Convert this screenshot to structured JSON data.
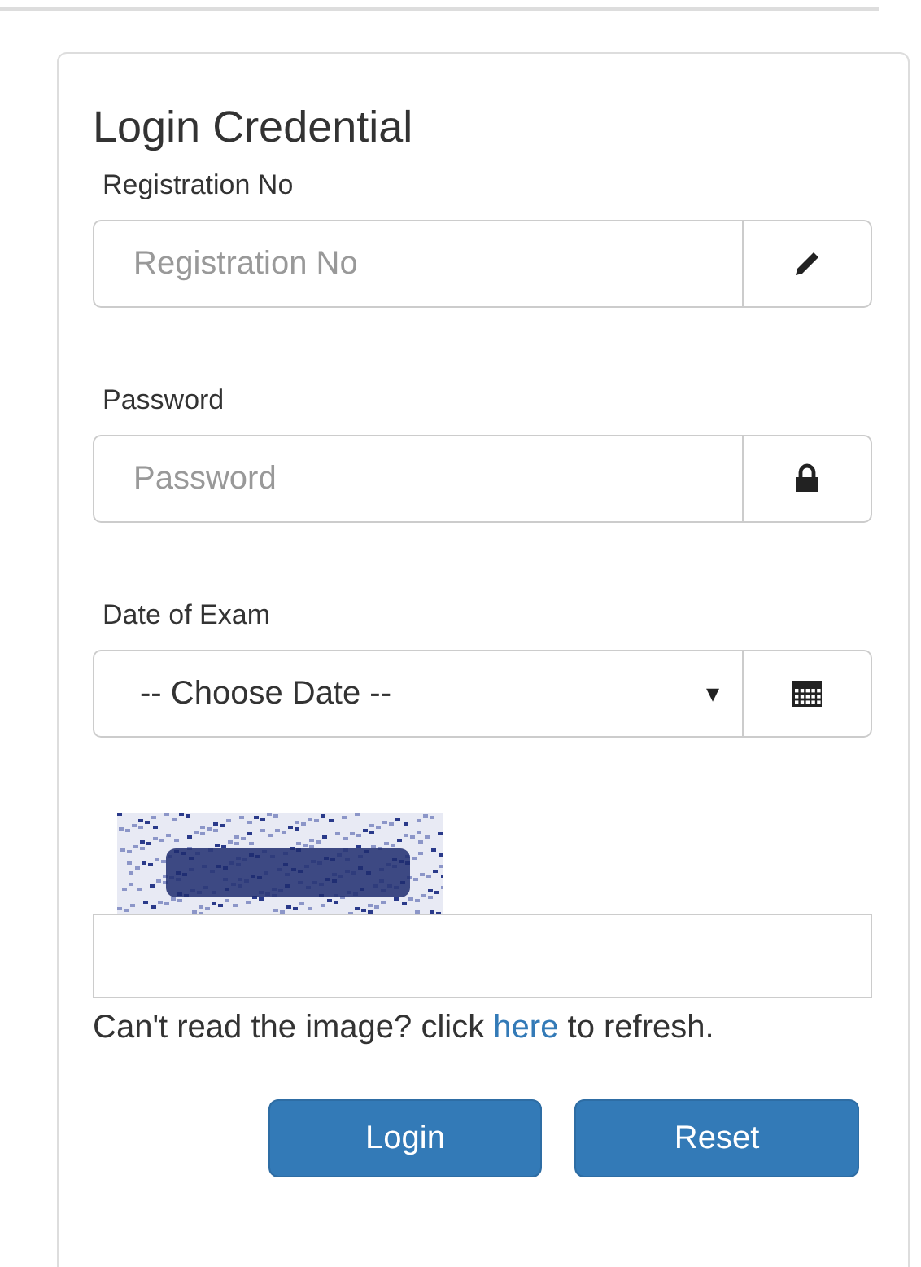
{
  "panel": {
    "title": "Login Credential"
  },
  "fields": [
    {
      "kind": "text",
      "label": "Registration No",
      "placeholder": "Registration No"
    },
    {
      "kind": "password",
      "label": "Password",
      "placeholder": "Password"
    },
    {
      "kind": "select",
      "label": "Date of Exam",
      "value": "-- Choose Date --",
      "caret": "▾"
    }
  ],
  "captcha": {
    "help_before": "Can't read the image? click",
    "link": "here",
    "help_after": "to refresh."
  },
  "buttons": [
    "Login",
    "Reset"
  ]
}
